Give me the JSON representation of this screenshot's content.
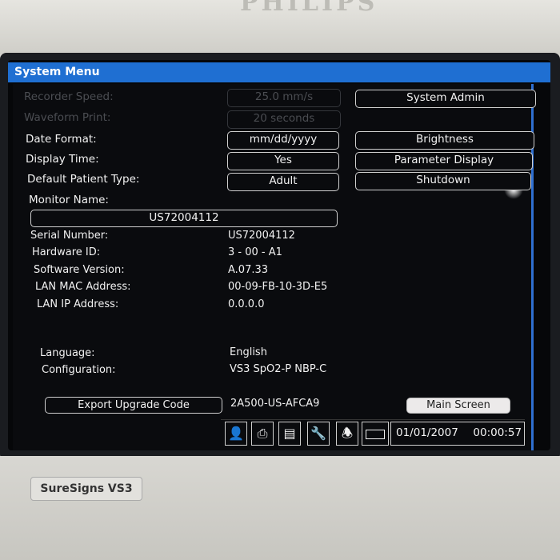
{
  "device": {
    "brand": "PHILIPS",
    "model": "SureSigns VS3"
  },
  "window": {
    "title": "System Menu"
  },
  "settings": {
    "recorder_speed": {
      "label": "Recorder Speed:",
      "value": "25.0 mm/s"
    },
    "waveform_print": {
      "label": "Waveform Print:",
      "value": "20 seconds"
    },
    "date_format": {
      "label": "Date Format:",
      "value": "mm/dd/yyyy"
    },
    "display_time": {
      "label": "Display Time:",
      "value": "Yes"
    },
    "default_patient_type": {
      "label": "Default Patient Type:",
      "value": "Adult"
    },
    "monitor_name": {
      "label": "Monitor Name:",
      "value": "US72004112"
    }
  },
  "side_buttons": {
    "system_admin": "System Admin",
    "brightness": "Brightness",
    "parameter_display": "Parameter Display",
    "shutdown": "Shutdown"
  },
  "info": {
    "serial_number": {
      "label": "Serial Number:",
      "value": "US72004112"
    },
    "hardware_id": {
      "label": "Hardware ID:",
      "value": "3 - 00 - A1"
    },
    "software_version": {
      "label": "Software Version:",
      "value": "A.07.33"
    },
    "lan_mac": {
      "label": "LAN MAC Address:",
      "value": "00-09-FB-10-3D-E5"
    },
    "lan_ip": {
      "label": "LAN IP Address:",
      "value": "0.0.0.0"
    },
    "language": {
      "label": "Language:",
      "value": "English"
    },
    "configuration": {
      "label": "Configuration:",
      "value": "VS3 SpO2-P NBP-C"
    }
  },
  "footer": {
    "export_button": "Export Upgrade Code",
    "upgrade_code": "2A500-US-AFCA9",
    "main_screen_button": "Main Screen"
  },
  "status_bar": {
    "icons": [
      "patient-icon",
      "print-icon",
      "review-icon",
      "tools-icon",
      "alarm-bell-icon",
      "battery-icon"
    ],
    "date": "01/01/2007",
    "time": "00:00:57"
  },
  "colors": {
    "title_bar": "#1f6fd2",
    "screen_bg": "#0a0b0e",
    "text": "#f2f2f2",
    "disabled": "#4b4d52"
  }
}
